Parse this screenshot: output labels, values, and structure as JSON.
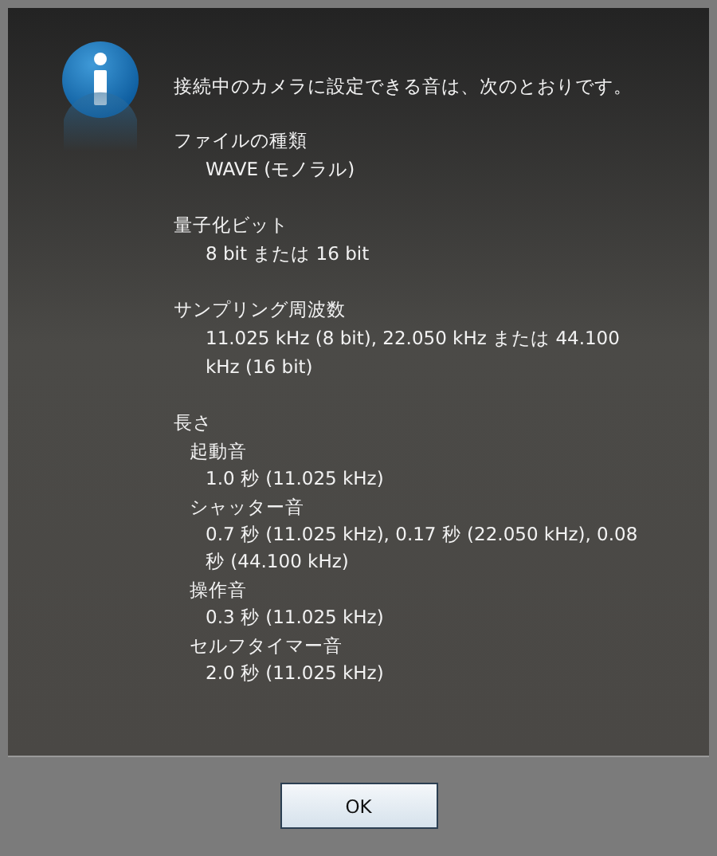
{
  "message": "接続中のカメラに設定できる音は、次のとおりです。",
  "sections": [
    {
      "title": "ファイルの種類",
      "value": "WAVE (モノラル)"
    },
    {
      "title": "量子化ビット",
      "value": "8 bit または 16 bit"
    },
    {
      "title": "サンプリング周波数",
      "value": "11.025 kHz (8 bit), 22.050 kHz または 44.100 kHz (16 bit)"
    }
  ],
  "length": {
    "title": "長さ",
    "items": [
      {
        "name": "起動音",
        "value": "1.0 秒 (11.025 kHz)"
      },
      {
        "name": "シャッター音",
        "value": "0.7 秒 (11.025 kHz), 0.17 秒 (22.050 kHz), 0.08 秒 (44.100 kHz)"
      },
      {
        "name": "操作音",
        "value": "0.3 秒 (11.025 kHz)"
      },
      {
        "name": "セルフタイマー音",
        "value": "2.0 秒 (11.025 kHz)"
      }
    ]
  },
  "buttons": [
    "OK"
  ]
}
